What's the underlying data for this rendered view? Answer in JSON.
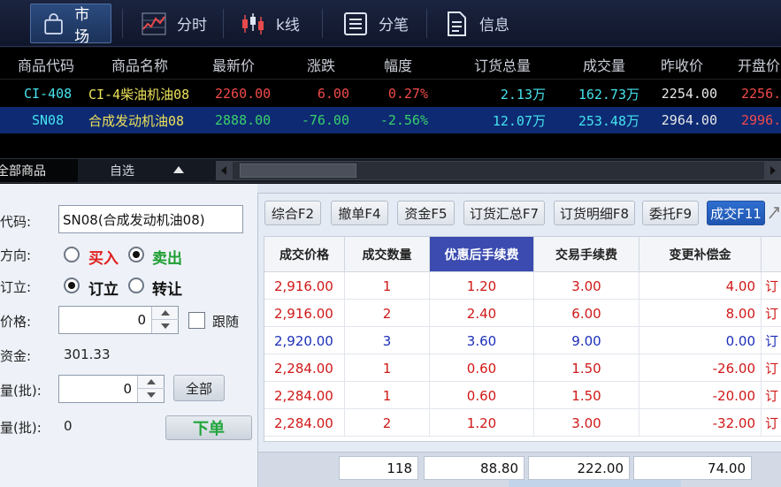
{
  "toolbar": {
    "items": [
      {
        "label": "市场",
        "icon": "bag-icon",
        "active": true
      },
      {
        "label": "分时",
        "icon": "line-chart-icon",
        "active": false
      },
      {
        "label": "k线",
        "icon": "candlestick-icon",
        "active": false
      },
      {
        "label": "分笔",
        "icon": "list-icon",
        "active": false
      },
      {
        "label": "信息",
        "icon": "document-icon",
        "active": false
      }
    ]
  },
  "quote": {
    "headers": [
      "商品代码",
      "商品名称",
      "最新价",
      "涨跌",
      "幅度",
      "订货总量",
      "成交量",
      "昨收价",
      "开盘价"
    ],
    "rows": [
      {
        "code": "CI-408",
        "name": "CI-4柴油机油08",
        "last": "2260.00",
        "change": "6.00",
        "pct": "0.27%",
        "order_total": "2.13万",
        "volume": "162.73万",
        "prev_close": "2254.00",
        "open": "2256."
      },
      {
        "code": "SN08",
        "name": "合成发动机油08",
        "last": "2888.00",
        "change": "-76.00",
        "pct": "-2.56%",
        "order_total": "12.07万",
        "volume": "253.48万",
        "prev_close": "2964.00",
        "open": "2996."
      }
    ]
  },
  "tabs": {
    "all": "全部商品",
    "fav": "自选"
  },
  "form": {
    "code_label": "代码:",
    "code_value": "SN08(合成发动机油08)",
    "direction_label": "方向:",
    "buy_label": "买入",
    "sell_label": "卖出",
    "direction_selected": "sell",
    "open_label": "订立:",
    "open_opt": "订立",
    "close_opt": "转让",
    "open_selected": "open",
    "price_label": "价格:",
    "price_value": "0",
    "follow_label": "跟随",
    "funds_label": "资金:",
    "funds_value": "301.33",
    "qty_label": "量(批):",
    "qty_value": "0",
    "all_button": "全部",
    "max_label": "量(批):",
    "max_value": "0",
    "order_button": "下单"
  },
  "right_tabs": [
    {
      "label": "综合F2",
      "active": false
    },
    {
      "label": "撤单F4",
      "active": false
    },
    {
      "label": "资金F5",
      "active": false
    },
    {
      "label": "订货汇总F7",
      "active": false
    },
    {
      "label": "订货明细F8",
      "active": false
    },
    {
      "label": "委托F9",
      "active": false
    },
    {
      "label": "成交F11",
      "active": true
    }
  ],
  "trades": {
    "headers": [
      "成交价格",
      "成交数量",
      "优惠后手续费",
      "交易手续费",
      "变更补偿金"
    ],
    "selected_header": "优惠后手续费",
    "rows": [
      {
        "price": "2,916.00",
        "qty": "1",
        "disc_fee": "1.20",
        "fee": "3.00",
        "comp": "4.00",
        "color": "red"
      },
      {
        "price": "2,916.00",
        "qty": "2",
        "disc_fee": "2.40",
        "fee": "6.00",
        "comp": "8.00",
        "color": "red"
      },
      {
        "price": "2,920.00",
        "qty": "3",
        "disc_fee": "3.60",
        "fee": "9.00",
        "comp": "0.00",
        "color": "blue"
      },
      {
        "price": "2,284.00",
        "qty": "1",
        "disc_fee": "0.60",
        "fee": "1.50",
        "comp": "-26.00",
        "color": "red"
      },
      {
        "price": "2,284.00",
        "qty": "1",
        "disc_fee": "0.60",
        "fee": "1.50",
        "comp": "-20.00",
        "color": "red"
      },
      {
        "price": "2,284.00",
        "qty": "2",
        "disc_fee": "1.20",
        "fee": "3.00",
        "comp": "-32.00",
        "color": "red"
      }
    ],
    "trailing_char": "订",
    "totals": {
      "qty": "118",
      "disc_fee": "88.80",
      "fee": "222.00",
      "comp": "74.00"
    }
  },
  "colors": {
    "toolbar_bg": "#10162a",
    "quote_bg": "#000000",
    "selected_row": "#0d2a73",
    "up": "#f24a4a",
    "down": "#39d06c",
    "code": "#46e3ef",
    "name": "#ece25a",
    "active_tab": "#1e55b0"
  }
}
